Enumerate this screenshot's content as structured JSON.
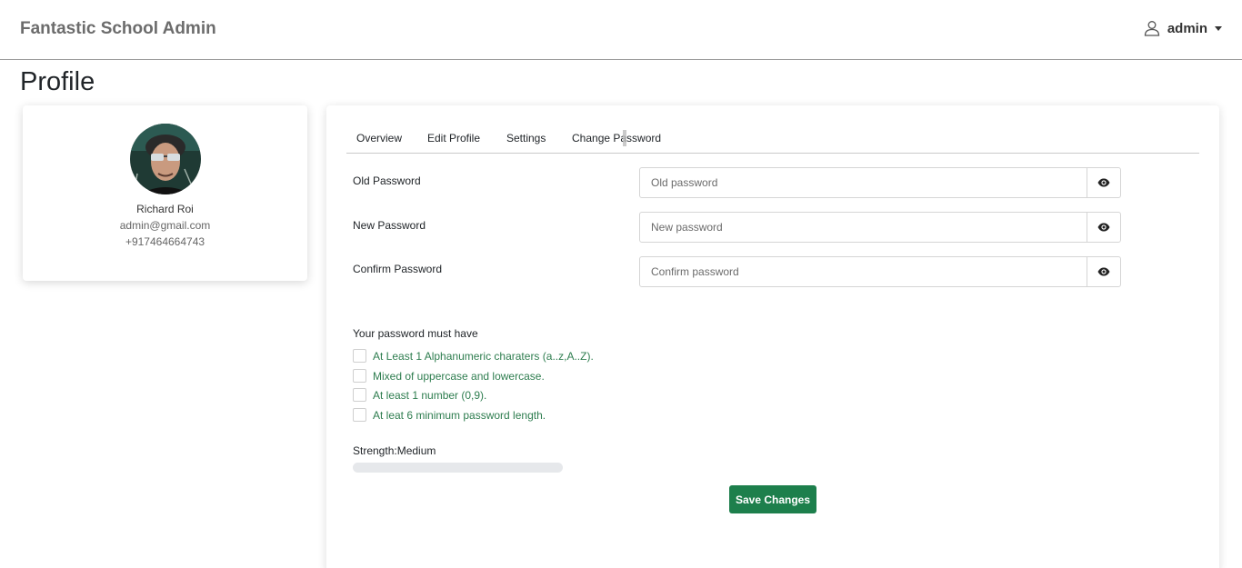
{
  "navbar": {
    "brand": "Fantastic School Admin",
    "user_name": "admin",
    "user_icon": "user-icon",
    "caret_icon": "caret-down-icon"
  },
  "page": {
    "title": "Profile"
  },
  "profile": {
    "name": "Richard Roi",
    "email": "admin@gmail.com",
    "phone": "+917464664743"
  },
  "tabs": [
    {
      "label": "Overview"
    },
    {
      "label": "Edit Profile"
    },
    {
      "label": "Settings"
    },
    {
      "label": "Change Password"
    }
  ],
  "form": {
    "old": {
      "label": "Old Password",
      "placeholder": "Old password",
      "value": ""
    },
    "new": {
      "label": "New Password",
      "placeholder": "New password",
      "value": ""
    },
    "confirm": {
      "label": "Confirm Password",
      "placeholder": "Confirm password",
      "value": ""
    }
  },
  "requirements": {
    "title": "Your password must have",
    "items": [
      "At Least 1 Alphanumeric charaters (a..z,A..Z).",
      "Mixed of uppercase and lowercase.",
      "At least 1 number (0,9).",
      "At leat 6 minimum password length."
    ]
  },
  "strength": {
    "label": "Strength:Medium"
  },
  "actions": {
    "save_label": "Save Changes"
  },
  "colors": {
    "accent": "#1d7f4c",
    "requirement_text": "#2e7d4f",
    "brand_text": "#6c6c6c"
  }
}
